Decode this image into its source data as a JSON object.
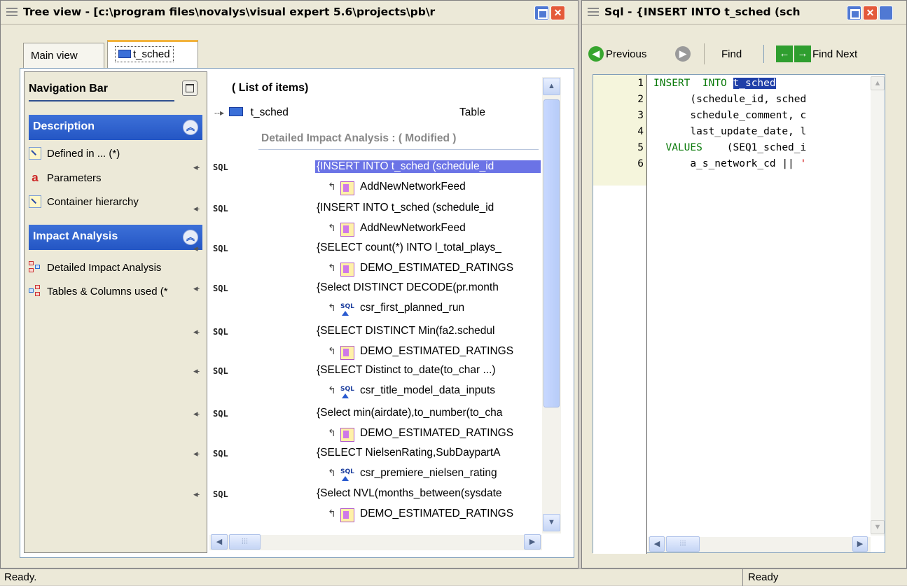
{
  "tree_window": {
    "title": "Tree view - [c:\\program files\\novalys\\visual expert 5.6\\projects\\pb\\r",
    "tabs": [
      {
        "label": "Main view"
      },
      {
        "label": "t_sched"
      }
    ]
  },
  "navigation": {
    "title": "Navigation Bar",
    "sections": [
      {
        "header": "Description",
        "items": [
          {
            "label": "Defined in ... (*)",
            "icon": "defined-in-icon"
          },
          {
            "label": "Parameters",
            "icon": "parameters-icon"
          },
          {
            "label": "Container hierarchy",
            "icon": "container-hierarchy-icon"
          }
        ]
      },
      {
        "header": "Impact Analysis",
        "items": [
          {
            "label": "Detailed Impact Analysis",
            "icon": "impact-analysis-icon"
          },
          {
            "label": "Tables & Columns used (*",
            "icon": "tables-columns-icon"
          }
        ]
      }
    ]
  },
  "list": {
    "header": "( List of items)",
    "root": {
      "name": "t_sched",
      "type": "Table"
    },
    "group_label": "Detailed Impact Analysis : ( Modified )",
    "sql_tag": "SQL",
    "entries": [
      {
        "statement": "{INSERT INTO t_sched (schedule_id",
        "child": "AddNewNetworkFeed",
        "child_icon": "pb-function-icon",
        "selected": true
      },
      {
        "statement": "{INSERT INTO t_sched (schedule_id",
        "child": "AddNewNetworkFeed",
        "child_icon": "pb-function-icon"
      },
      {
        "statement": "{SELECT count(*) INTO l_total_plays_",
        "child": "DEMO_ESTIMATED_RATINGS",
        "child_icon": "pb-function-icon"
      },
      {
        "statement": "{Select DISTINCT DECODE(pr.month",
        "child": "csr_first_planned_run",
        "child_icon": "sql-procedure-icon"
      },
      {
        "statement": "{SELECT DISTINCT Min(fa2.schedul",
        "child": "DEMO_ESTIMATED_RATINGS",
        "child_icon": "pb-function-icon"
      },
      {
        "statement": "{SELECT Distinct to_date(to_char ...)",
        "child": "csr_title_model_data_inputs",
        "child_icon": "sql-procedure-icon"
      },
      {
        "statement": "{Select min(airdate),to_number(to_cha",
        "child": "DEMO_ESTIMATED_RATINGS",
        "child_icon": "pb-function-icon"
      },
      {
        "statement": "{SELECT NielsenRating,SubDaypartA",
        "child": "csr_premiere_nielsen_rating",
        "child_icon": "sql-procedure-icon"
      },
      {
        "statement": "{Select NVL(months_between(sysdate",
        "child": "DEMO_ESTIMATED_RATINGS",
        "child_icon": "pb-function-icon"
      }
    ]
  },
  "sql_window": {
    "title": "Sql - {INSERT INTO t_sched (sch",
    "toolbar": {
      "previous": "Previous",
      "find": "Find",
      "find_next": "Find Next"
    },
    "code": [
      {
        "no": "1",
        "kw": "INSERT",
        "mid": "  INTO ",
        "hl": "t_sched",
        "rest": ""
      },
      {
        "no": "2",
        "text": "      (schedule_id, sched"
      },
      {
        "no": "3",
        "text": "      schedule_comment, c"
      },
      {
        "no": "4",
        "text": "      last_update_date, l"
      },
      {
        "no": "5",
        "kw": "  VALUES",
        "rest": "    (SEQ1_sched_i"
      },
      {
        "no": "6",
        "text": "      a_s_network_cd || ",
        "str": "'"
      }
    ]
  },
  "status": {
    "left": "Ready.",
    "right": "Ready"
  },
  "colors": {
    "selection": "#6b73e6",
    "section_header": "#2456c4",
    "keyword": "#0a7a0a",
    "highlight": "#1f3fa8"
  }
}
